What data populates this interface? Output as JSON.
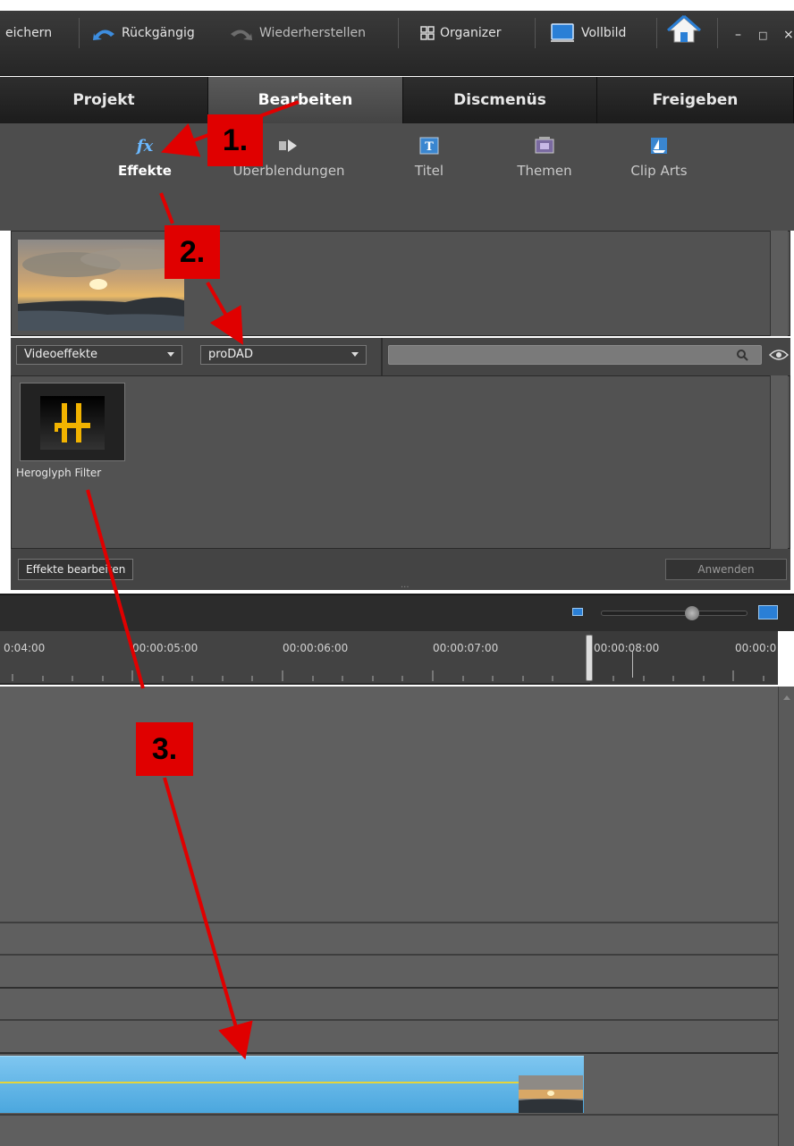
{
  "toolbar": {
    "save_label": "eichern",
    "undo_label": "Rückgängig",
    "redo_label": "Wiederherstellen",
    "organizer_label": "Organizer",
    "fullscreen_label": "Vollbild"
  },
  "tabs": [
    {
      "label": "Projekt"
    },
    {
      "label": "Bearbeiten"
    },
    {
      "label": "Discmenüs"
    },
    {
      "label": "Freigeben"
    }
  ],
  "subtools": [
    {
      "label": "Effekte"
    },
    {
      "label": "Überblendungen"
    },
    {
      "label": "Titel"
    },
    {
      "label": "Themen"
    },
    {
      "label": "Clip Arts"
    }
  ],
  "filters": {
    "category": "Videoeffekte",
    "vendor": "proDAD"
  },
  "effect": {
    "label": "Heroglyph Filter"
  },
  "buttons": {
    "edit_effects": "Effekte bearbeiten",
    "apply": "Anwenden"
  },
  "timeline": {
    "ticks": [
      "0:04:00",
      "00:00:05:00",
      "00:00:06:00",
      "00:00:07:00",
      "00:00:08:00",
      "00:00:0"
    ]
  },
  "annotations": {
    "step1": "1.",
    "step2": "2.",
    "step3": "3."
  },
  "colors": {
    "annotation_red": "#e00000",
    "clip_blue": "#5ab3e6",
    "accent_blue": "#2a7fd6",
    "effect_gold": "#f2b300"
  }
}
